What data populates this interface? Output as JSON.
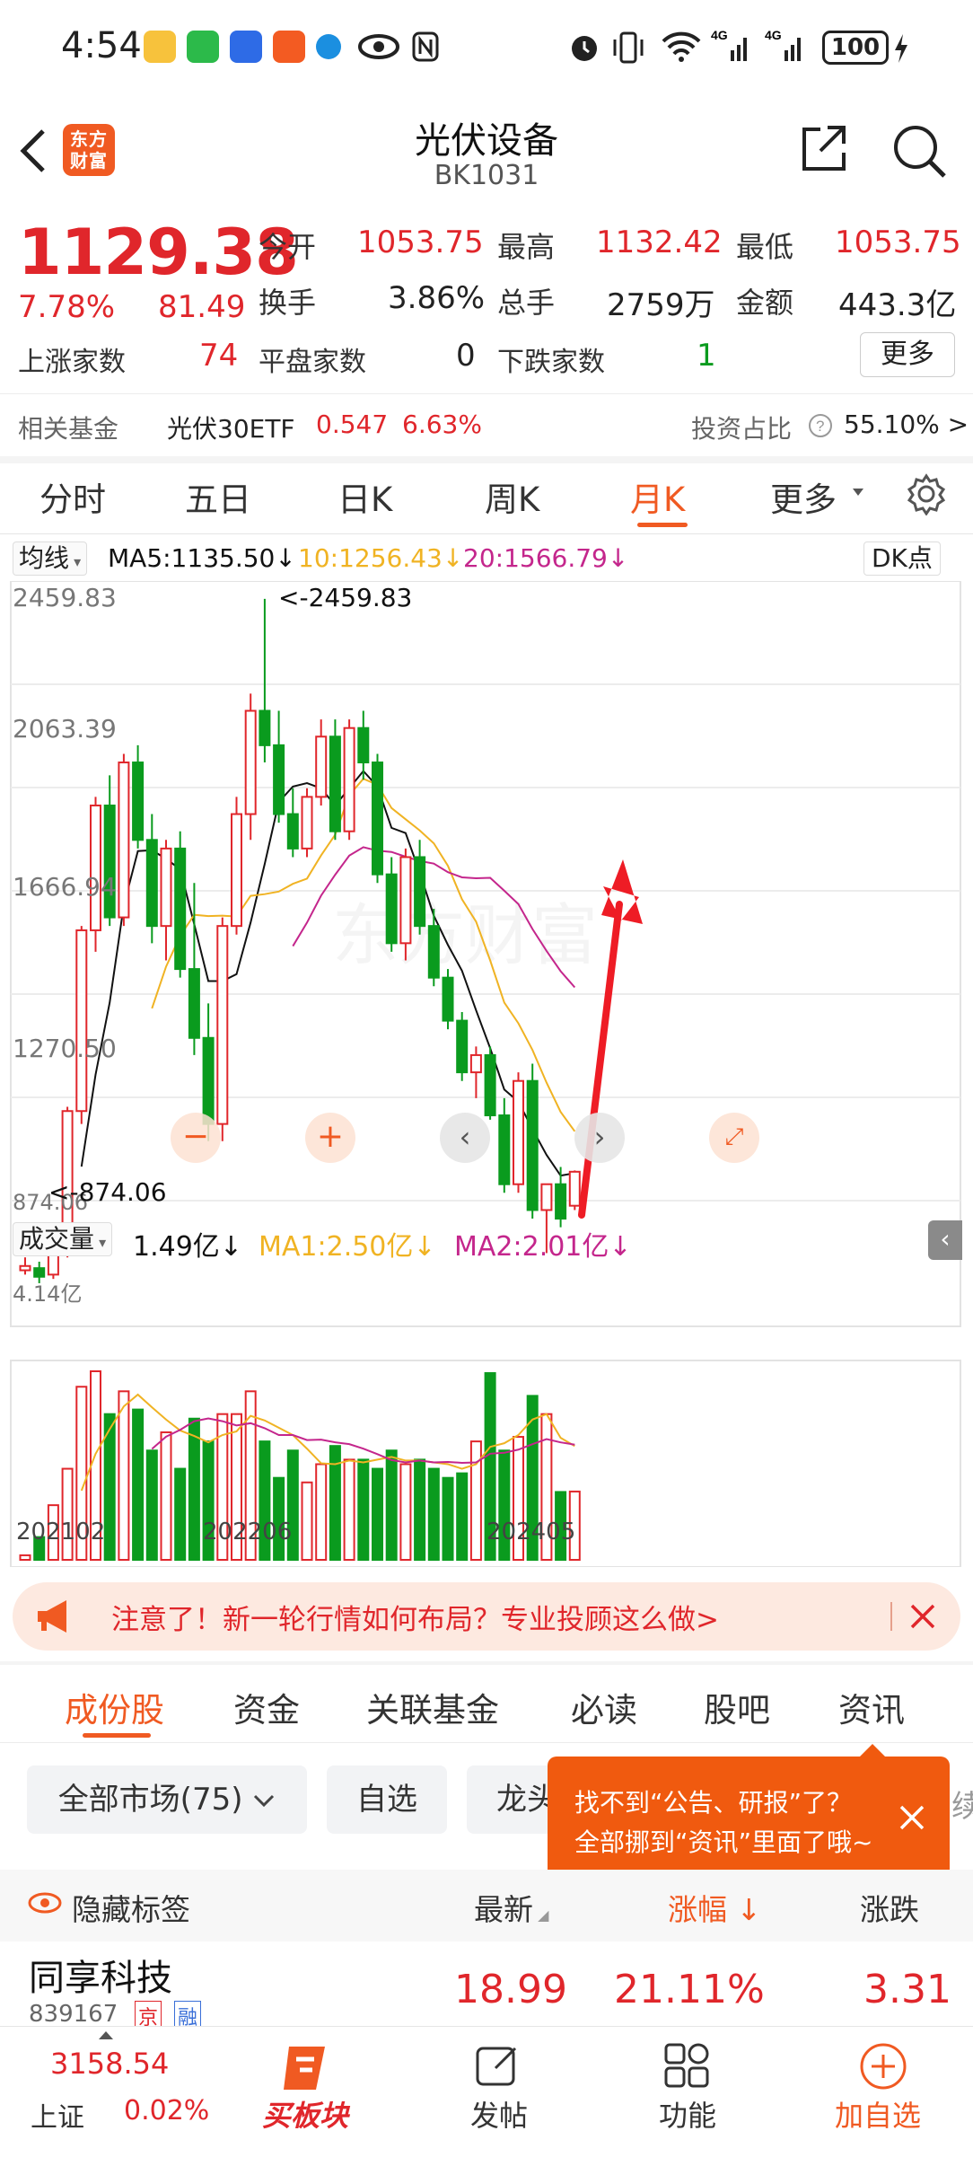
{
  "status_bar": {
    "time": "4:54",
    "battery": "100",
    "network": [
      "4G",
      "4G"
    ]
  },
  "header": {
    "title": "光伏设备",
    "code": "BK1031",
    "logo_text": "东方财富"
  },
  "quote": {
    "price": "1129.38",
    "change_pct": "7.78%",
    "change_abs": "81.49",
    "open_label": "今开",
    "open": "1053.75",
    "high_label": "最高",
    "high": "1132.42",
    "low_label": "最低",
    "low": "1053.75",
    "turnover_rate_label": "换手",
    "turnover_rate": "3.86%",
    "volume_label": "总手",
    "volume": "2759万",
    "amount_label": "金额",
    "amount": "443.3亿",
    "up_count_label": "上涨家数",
    "up_count": "74",
    "flat_count_label": "平盘家数",
    "flat_count": "0",
    "down_count_label": "下跌家数",
    "down_count": "1",
    "more_label": "更多",
    "fund_label": "相关基金",
    "fund_name": "光伏30ETF",
    "fund_price": "0.547",
    "fund_pct": "6.63%",
    "invest_ratio_label": "投资占比",
    "invest_ratio": "55.10% >"
  },
  "period_tabs": [
    {
      "label": "分时"
    },
    {
      "label": "五日"
    },
    {
      "label": "日K"
    },
    {
      "label": "周K"
    },
    {
      "label": "月K",
      "active": true
    },
    {
      "label": "更多"
    }
  ],
  "chart": {
    "ma_selector": "均线",
    "ma5": "MA5:1135.50↓",
    "ma10": "10:1256.43↓",
    "ma20": "20:1566.79↓",
    "dk_label": "DK点",
    "y_ticks": [
      "2459.83",
      "2063.39",
      "1666.94",
      "1270.50"
    ],
    "low_tick": "874.06",
    "max_annotation": "<-2459.83",
    "min_annotation": "<-874.06",
    "vol_selector": "成交量",
    "vol": "1.49亿↓",
    "vol_ma1": "MA1:2.50亿↓",
    "vol_ma2": "MA2:2.01亿↓",
    "vol_max_tick": "4.14亿",
    "x_ticks": [
      "202102",
      "202206",
      "202405"
    ],
    "colors": {
      "up": "#e0262b",
      "down": "#0a9b1e",
      "ma5": "#111111",
      "ma10": "#f0b323",
      "ma20": "#c4268c",
      "arrow": "#ee1c25"
    }
  },
  "chart_data": {
    "type": "candlestick",
    "ylim": [
      874.06,
      2459.83
    ],
    "candles": [
      [
        900,
        930,
        890,
        910
      ],
      [
        905,
        920,
        870,
        885
      ],
      [
        890,
        960,
        880,
        950
      ],
      [
        950,
        1280,
        930,
        1270
      ],
      [
        1270,
        1700,
        1240,
        1690
      ],
      [
        1690,
        2000,
        1640,
        1980
      ],
      [
        1980,
        2050,
        1700,
        1720
      ],
      [
        1720,
        2100,
        1700,
        2080
      ],
      [
        2080,
        2120,
        1880,
        1900
      ],
      [
        1900,
        1960,
        1660,
        1700
      ],
      [
        1700,
        1900,
        1620,
        1880
      ],
      [
        1880,
        1920,
        1580,
        1600
      ],
      [
        1600,
        1800,
        1400,
        1440
      ],
      [
        1440,
        1520,
        1200,
        1240
      ],
      [
        1240,
        1720,
        1200,
        1700
      ],
      [
        1700,
        2000,
        1680,
        1960
      ],
      [
        1960,
        2240,
        1900,
        2200
      ],
      [
        2200,
        2460,
        2080,
        2120
      ],
      [
        2120,
        2200,
        1940,
        1960
      ],
      [
        1960,
        2020,
        1860,
        1880
      ],
      [
        1880,
        2020,
        1860,
        2000
      ],
      [
        2000,
        2180,
        1980,
        2140
      ],
      [
        2140,
        2180,
        1900,
        1920
      ],
      [
        1920,
        2180,
        1900,
        2160
      ],
      [
        2160,
        2200,
        2040,
        2080
      ],
      [
        2080,
        2100,
        1800,
        1820
      ],
      [
        1820,
        1860,
        1640,
        1660
      ],
      [
        1660,
        1880,
        1620,
        1860
      ],
      [
        1860,
        1900,
        1680,
        1700
      ],
      [
        1700,
        1740,
        1560,
        1580
      ],
      [
        1580,
        1600,
        1460,
        1480
      ],
      [
        1480,
        1500,
        1340,
        1360
      ],
      [
        1360,
        1420,
        1300,
        1400
      ],
      [
        1400,
        1420,
        1250,
        1260
      ],
      [
        1260,
        1300,
        1080,
        1100
      ],
      [
        1100,
        1360,
        1080,
        1340
      ],
      [
        1340,
        1380,
        1020,
        1040
      ],
      [
        1040,
        1060,
        940,
        1100
      ],
      [
        1100,
        1140,
        1000,
        1020
      ],
      [
        1050,
        1132,
        1040,
        1129
      ]
    ],
    "volume": [
      0.1,
      0.5,
      1.2,
      2.0,
      3.8,
      4.14,
      3.2,
      3.7,
      3.3,
      2.4,
      2.8,
      2.0,
      3.1,
      2.6,
      3.2,
      3.2,
      3.7,
      2.6,
      1.8,
      2.4,
      1.7,
      2.1,
      2.5,
      2.2,
      2.2,
      2.0,
      2.4,
      2.1,
      2.2,
      2.0,
      1.8,
      1.9,
      2.6,
      4.1,
      2.4,
      2.7,
      3.6,
      3.2,
      1.49,
      1.5
    ]
  },
  "banner": {
    "text": "注意了！新一轮行情如何布局？专业投顾这么做>"
  },
  "sub_tabs": [
    {
      "label": "成份股",
      "active": true
    },
    {
      "label": "资金"
    },
    {
      "label": "关联基金"
    },
    {
      "label": "必读"
    },
    {
      "label": "股吧"
    },
    {
      "label": "资讯"
    }
  ],
  "filters": [
    {
      "label": "全部市场(75)"
    },
    {
      "label": "自选"
    },
    {
      "label": "龙头"
    }
  ],
  "tooltip": {
    "line1": "找不到“公告、研报”了？",
    "line2": "全部挪到“资讯”里面了哦~"
  },
  "list_header": {
    "hide_label": "隐藏标签",
    "latest": "最新",
    "change_pct": "涨幅",
    "change": "涨跌"
  },
  "rows": [
    {
      "name": "同享科技",
      "code": "839167",
      "tag1": "京",
      "tag2": "融",
      "latest": "18.99",
      "change_pct": "21.11%",
      "change": "3.31"
    }
  ],
  "bottom_nav": {
    "index_value": "3158.54",
    "index_name": "上证",
    "index_pct": "0.02%",
    "items": [
      {
        "label": "买板块"
      },
      {
        "label": "发帖"
      },
      {
        "label": "功能"
      },
      {
        "label": "加自选"
      }
    ]
  }
}
